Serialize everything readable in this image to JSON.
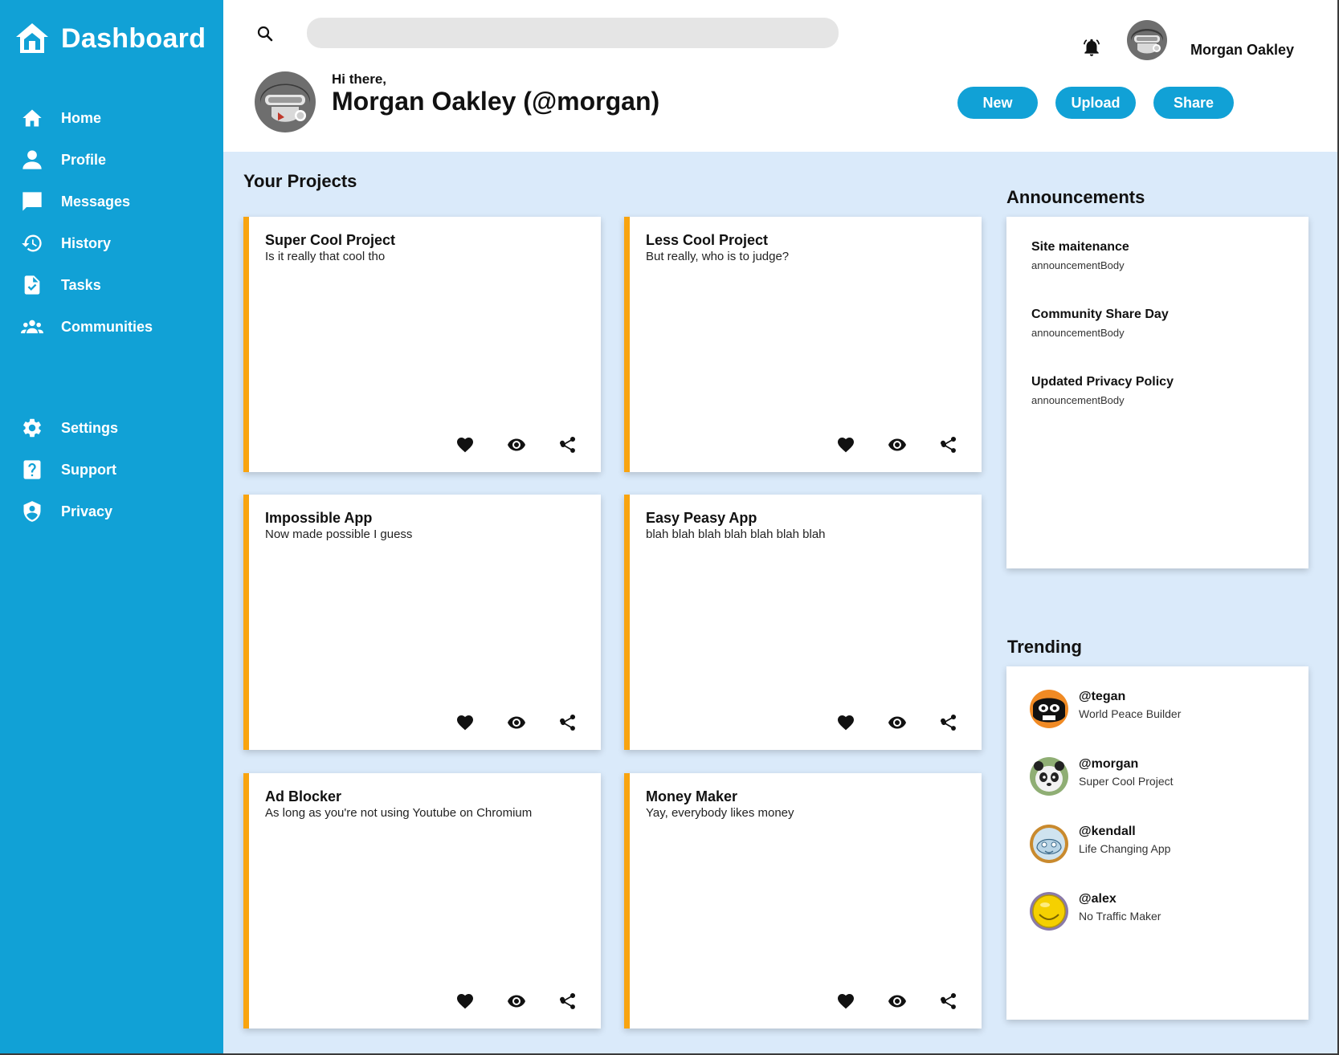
{
  "sidebar": {
    "brand": "Dashboard",
    "nav": [
      {
        "label": "Home",
        "icon": "home-icon"
      },
      {
        "label": "Profile",
        "icon": "person-icon"
      },
      {
        "label": "Messages",
        "icon": "chat-icon"
      },
      {
        "label": "History",
        "icon": "history-icon"
      },
      {
        "label": "Tasks",
        "icon": "task-icon"
      },
      {
        "label": "Communities",
        "icon": "group-icon"
      }
    ],
    "nav_bottom": [
      {
        "label": "Settings",
        "icon": "gear-icon"
      },
      {
        "label": "Support",
        "icon": "help-icon"
      },
      {
        "label": "Privacy",
        "icon": "shield-icon"
      }
    ]
  },
  "header": {
    "search_placeholder": "",
    "username": "Morgan Oakley",
    "greeting": "Hi there,",
    "full_name": "Morgan Oakley (@morgan)",
    "buttons": {
      "new": "New",
      "upload": "Upload",
      "share": "Share"
    }
  },
  "projects": {
    "title": "Your Projects",
    "items": [
      {
        "title": "Super Cool Project",
        "desc": "Is it really that cool tho"
      },
      {
        "title": "Less Cool Project",
        "desc": "But really, who is to judge?"
      },
      {
        "title": "Impossible App",
        "desc": "Now made possible I guess"
      },
      {
        "title": "Easy Peasy App",
        "desc": "blah blah blah blah blah blah blah"
      },
      {
        "title": "Ad Blocker",
        "desc": "As long as you're not using Youtube on Chromium"
      },
      {
        "title": "Money Maker",
        "desc": "Yay, everybody likes money"
      }
    ]
  },
  "announcements": {
    "title": "Announcements",
    "items": [
      {
        "title": "Site maitenance",
        "body": "announcementBody"
      },
      {
        "title": "Community Share Day",
        "body": "announcementBody"
      },
      {
        "title": "Updated Privacy Policy",
        "body": "announcementBody"
      }
    ]
  },
  "trending": {
    "title": "Trending",
    "items": [
      {
        "handle": "@tegan",
        "subtitle": "World Peace Builder"
      },
      {
        "handle": "@morgan",
        "subtitle": "Super Cool Project"
      },
      {
        "handle": "@kendall",
        "subtitle": "Life Changing App"
      },
      {
        "handle": "@alex",
        "subtitle": "No Traffic Maker"
      }
    ]
  },
  "colors": {
    "sidebar": "#11a1d6",
    "content_bg": "#daeafa",
    "card_accent": "#f9a40f",
    "button": "#11a1d6"
  }
}
